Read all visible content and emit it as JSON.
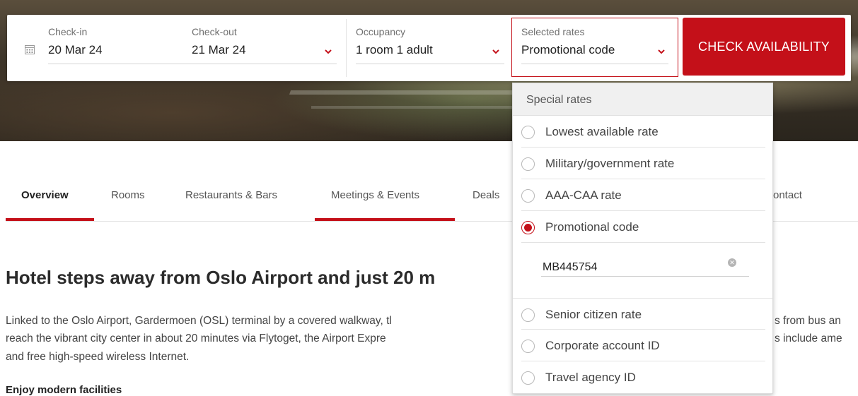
{
  "booking": {
    "check_in_label": "Check-in",
    "check_in_value": "20 Mar 24",
    "check_out_label": "Check-out",
    "check_out_value": "21 Mar 24",
    "occupancy_label": "Occupancy",
    "occupancy_value": "1 room  1 adult",
    "rates_label": "Selected rates",
    "rates_value": "Promotional code",
    "check_button": "CHECK AVAILABILITY"
  },
  "nav": {
    "tabs": [
      "Overview",
      "Rooms",
      "Restaurants & Bars",
      "Meetings & Events",
      "Deals"
    ],
    "active": "Overview",
    "contact_partial": "ontact"
  },
  "content": {
    "headline": "Hotel steps away from Oslo Airport and just 20 m",
    "para_line1": "Linked to the Oslo Airport, Gardermoen (OSL) terminal by a covered walkway, tl",
    "para_line1_right": "s from bus an",
    "para_line2": "reach the vibrant city center in about 20 minutes via Flytoget, the Airport Expre",
    "para_line2_right": "s include ame",
    "para_line3": "and free high-speed wireless Internet.",
    "subheading": "Enjoy modern facilities"
  },
  "dropdown": {
    "header": "Special rates",
    "options": [
      {
        "label": "Lowest available rate",
        "checked": false
      },
      {
        "label": "Military/government rate",
        "checked": false
      },
      {
        "label": "AAA-CAA rate",
        "checked": false
      },
      {
        "label": "Promotional code",
        "checked": true
      },
      {
        "label": "Senior citizen rate",
        "checked": false
      },
      {
        "label": "Corporate account ID",
        "checked": false
      },
      {
        "label": "Travel agency ID",
        "checked": false
      }
    ],
    "promo_code_value": "MB445754"
  },
  "colors": {
    "accent": "#c41019"
  }
}
